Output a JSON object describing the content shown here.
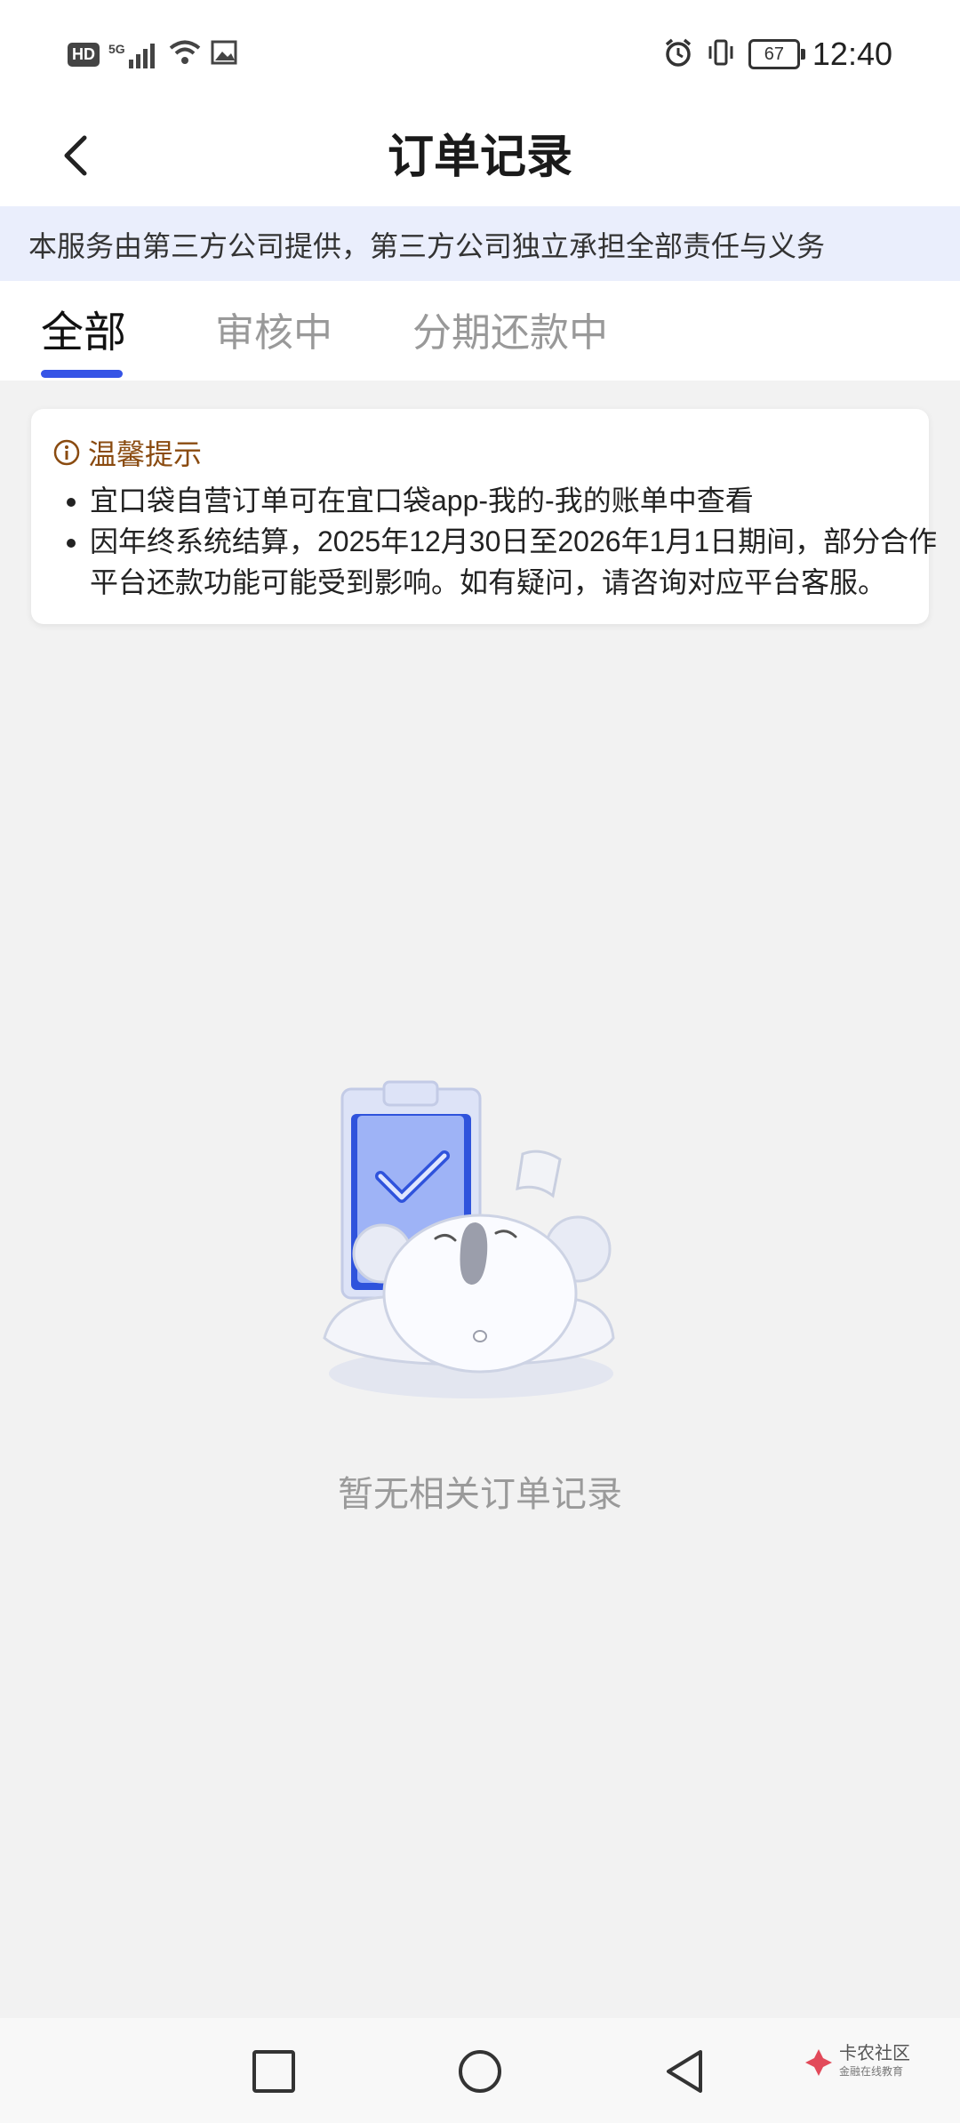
{
  "status_bar": {
    "hd_label": "HD",
    "network_label": "5G",
    "battery": "67",
    "time": "12:40"
  },
  "header": {
    "title": "订单记录"
  },
  "notice": {
    "text": "本服务由第三方公司提供，第三方公司独立承担全部责任与义务"
  },
  "tabs": [
    {
      "label": "全部",
      "active": true
    },
    {
      "label": "审核中",
      "active": false
    },
    {
      "label": "分期还款中",
      "active": false
    }
  ],
  "tip": {
    "title": "温馨提示",
    "items": [
      "宜口袋自营订单可在宜口袋app-我的-我的账单中查看",
      "因年终系统结算，2025年12月30日至2026年1月1日期间，部分合作平台还款功能可能受到影响。如有疑问，请咨询对应平台客服。"
    ]
  },
  "empty_state": {
    "message": "暂无相关订单记录"
  },
  "watermark": {
    "line1": "卡农社区",
    "line2": "金融在线教育"
  },
  "colors": {
    "accent": "#3654e6",
    "tip_title": "#8a4b10",
    "notice_bg": "#eaeefc"
  }
}
